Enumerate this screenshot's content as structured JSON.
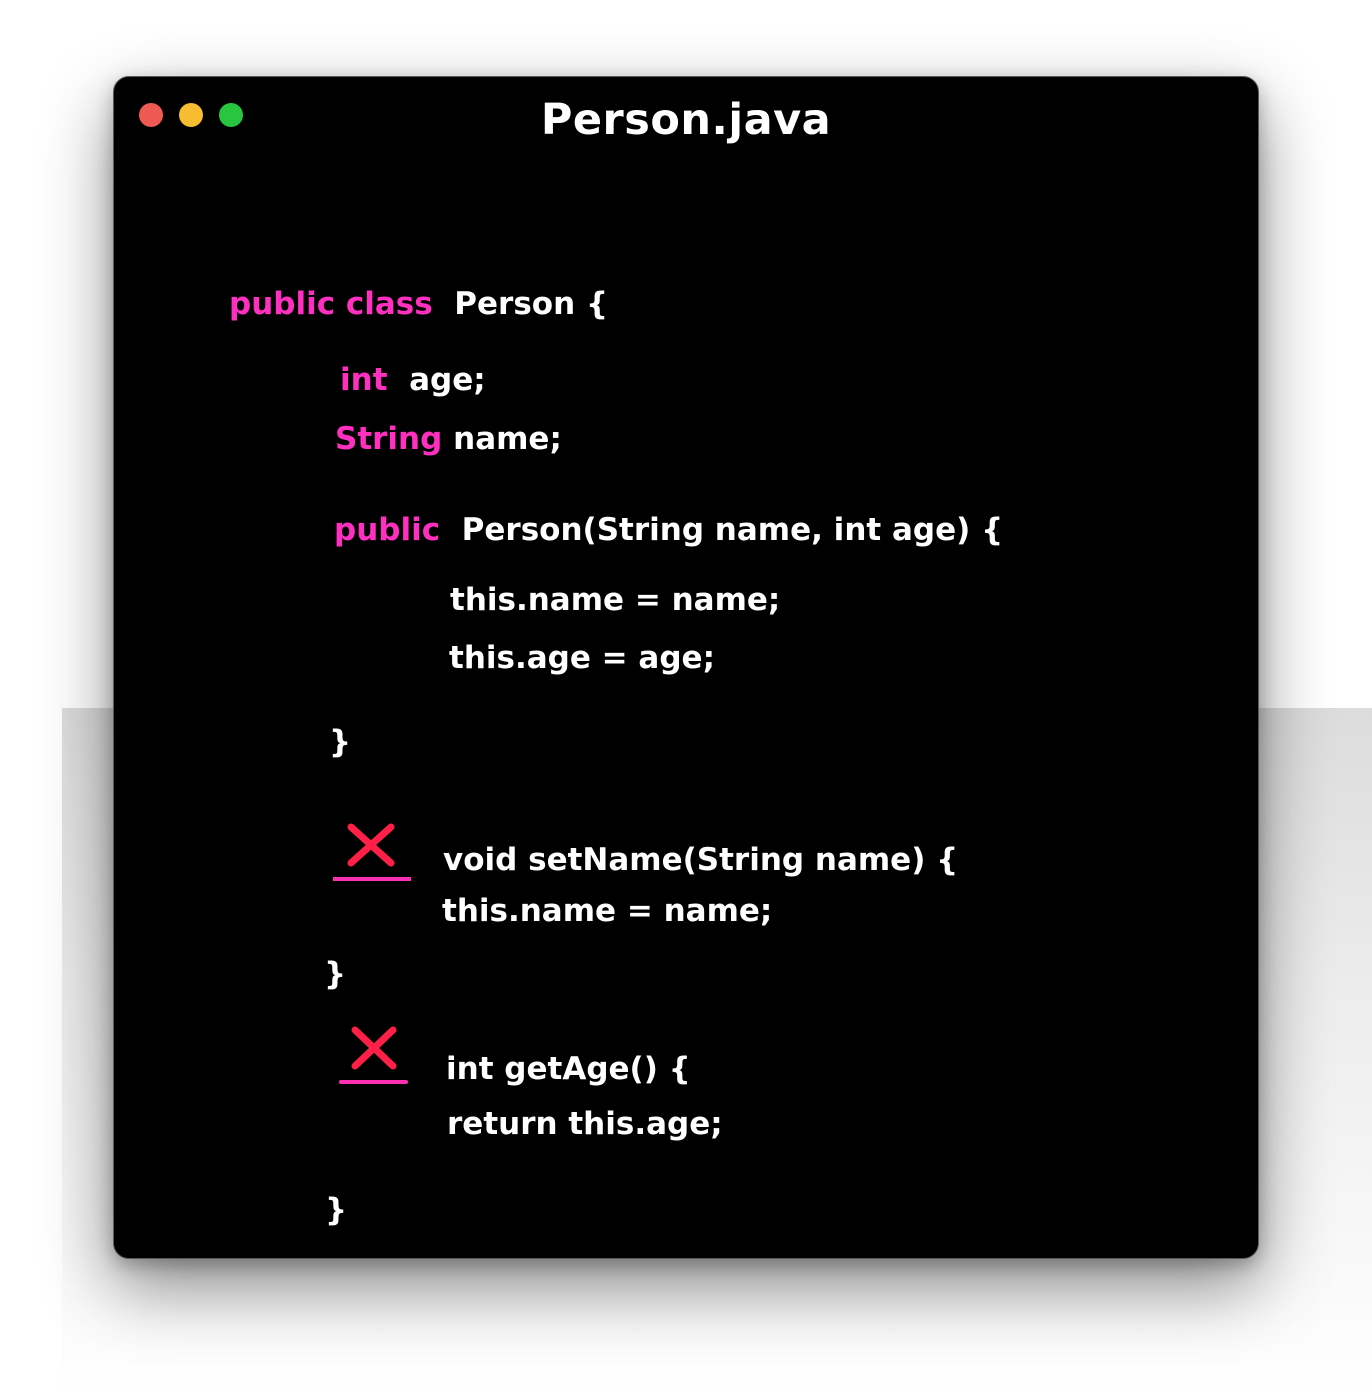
{
  "window": {
    "title": "Person.java",
    "buttons": {
      "close_color": "#ee5a52",
      "minimize_color": "#f5bd2f",
      "zoom_color": "#28c63f"
    }
  },
  "colors": {
    "keyword": "#ff2fc0",
    "text": "#ffffff",
    "cross": "#ff1f47",
    "underline": "#ff2fb3",
    "background": "#000000"
  },
  "code": {
    "class_keywords": "public class",
    "class_decl": "Person {",
    "field1_type": "int",
    "field1_name": "age;",
    "field2_type": "String",
    "field2_name": "name;",
    "ctor_keyword": "public",
    "ctor_signature": "Person(String name, int age) {",
    "ctor_body1": "this.name = name;",
    "ctor_body2": "this.age = age;",
    "ctor_close": "}",
    "setter_signature": "void setName(String name) {",
    "setter_body": "this.name = name;",
    "setter_close": "}",
    "getter_signature": "int getAge() {",
    "getter_body": "return this.age;",
    "getter_close": "}"
  },
  "annotations": [
    {
      "icon": "cross-mark-icon",
      "target": "setName"
    },
    {
      "icon": "cross-mark-icon",
      "target": "getAge"
    }
  ]
}
